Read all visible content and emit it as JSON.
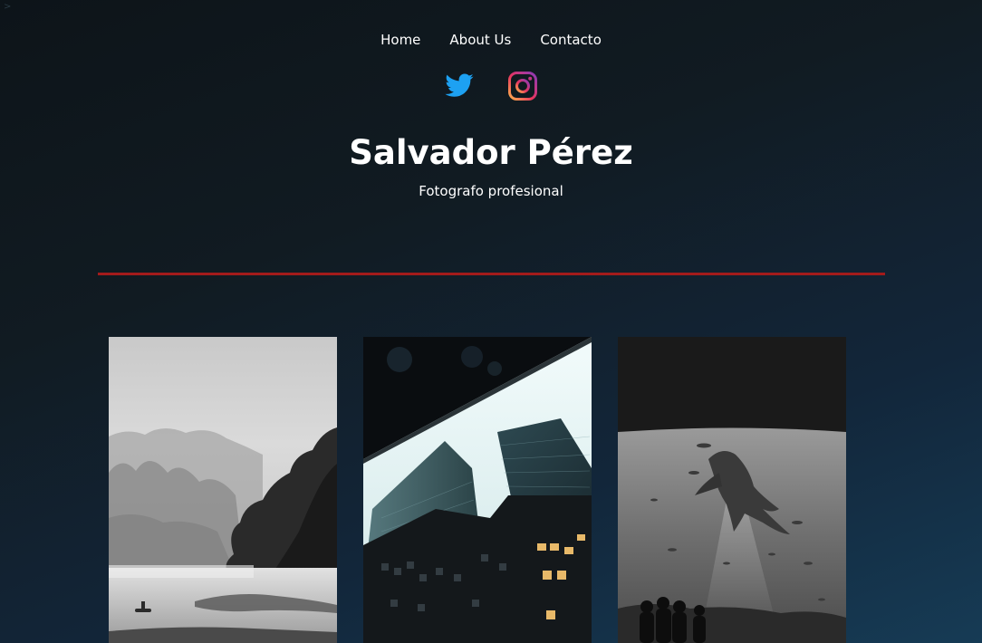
{
  "corner_mark": ">",
  "nav": {
    "items": [
      {
        "label": "Home"
      },
      {
        "label": "About Us"
      },
      {
        "label": "Contacto"
      }
    ]
  },
  "social": {
    "twitter_icon": "twitter-icon",
    "instagram_icon": "instagram-icon",
    "twitter_color": "#1da1f2"
  },
  "header": {
    "title": "Salvador Pérez",
    "subtitle": "Fotografo profesional"
  },
  "divider_color": "#a31b1b",
  "gallery": {
    "photos": [
      {
        "subject": "misty lake with boat, black and white"
      },
      {
        "subject": "skyscrapers from below"
      },
      {
        "subject": "aquarium whale shark with silhouettes, black and white"
      }
    ]
  }
}
